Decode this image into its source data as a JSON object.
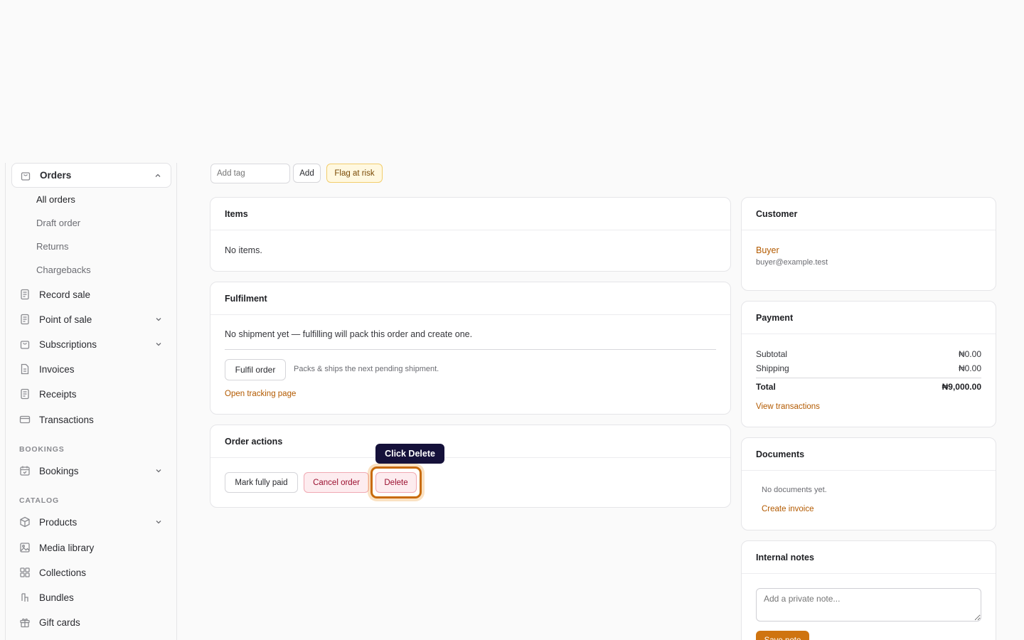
{
  "sidebar": {
    "orders": {
      "label": "Orders",
      "children": [
        "All orders",
        "Draft order",
        "Returns",
        "Chargebacks"
      ]
    },
    "items": [
      {
        "label": "Record sale"
      },
      {
        "label": "Point of sale"
      },
      {
        "label": "Subscriptions"
      },
      {
        "label": "Invoices"
      },
      {
        "label": "Receipts"
      },
      {
        "label": "Transactions"
      }
    ],
    "bookings_label": "BOOKINGS",
    "bookings": {
      "label": "Bookings"
    },
    "catalog_label": "CATALOG",
    "catalog": [
      {
        "label": "Products"
      },
      {
        "label": "Media library"
      },
      {
        "label": "Collections"
      },
      {
        "label": "Bundles"
      },
      {
        "label": "Gift cards"
      }
    ]
  },
  "tags": {
    "placeholder": "Add tag",
    "add_label": "Add",
    "flag_label": "Flag at risk"
  },
  "items_card": {
    "title": "Items",
    "empty": "No items."
  },
  "fulfilment": {
    "title": "Fulfilment",
    "message": "No shipment yet — fulfilling will pack this order and create one.",
    "button": "Fulfil order",
    "hint": "Packs & ships the next pending shipment.",
    "link": "Open tracking page"
  },
  "order_actions": {
    "title": "Order actions",
    "mark_paid": "Mark fully paid",
    "cancel": "Cancel order",
    "delete": "Delete",
    "tooltip": "Click Delete"
  },
  "customer": {
    "title": "Customer",
    "name": "Buyer",
    "email": "buyer@example.test"
  },
  "payment": {
    "title": "Payment",
    "subtotal_label": "Subtotal",
    "subtotal": "₦0.00",
    "shipping_label": "Shipping",
    "shipping": "₦0.00",
    "total_label": "Total",
    "total": "₦9,000.00",
    "link": "View transactions"
  },
  "documents": {
    "title": "Documents",
    "empty": "No documents yet.",
    "link": "Create invoice"
  },
  "notes": {
    "title": "Internal notes",
    "placeholder": "Add a private note...",
    "save": "Save note"
  },
  "colors": {
    "accent": "#b35a00",
    "highlight": "#c86b0a",
    "tooltip_bg": "#15113a",
    "danger": "#9b1030"
  }
}
